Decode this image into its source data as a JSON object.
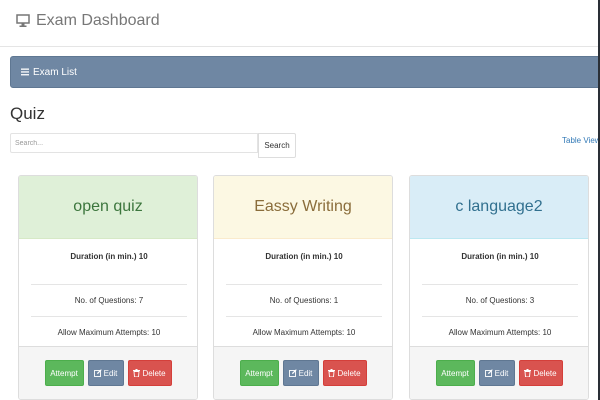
{
  "app": {
    "title": "Exam Dashboard",
    "icon": "monitor-icon"
  },
  "panel": {
    "heading": "Exam List",
    "icon": "list-icon"
  },
  "page": {
    "title": "Quiz"
  },
  "search": {
    "placeholder": "Search...",
    "button_label": "Search"
  },
  "table_view_link": "Table View",
  "cards": [
    {
      "title": "open quiz",
      "theme": "green",
      "duration": "Duration (in min.) 10",
      "questions": "No. of Questions: 7",
      "attempts": "Allow Maximum Attempts: 10",
      "attempt_label": "Attempt",
      "edit_label": "Edit",
      "delete_label": "Delete"
    },
    {
      "title": "Eassy Writing",
      "theme": "yellow",
      "duration": "Duration (in min.) 10",
      "questions": "No. of Questions: 1",
      "attempts": "Allow Maximum Attempts: 10",
      "attempt_label": "Attempt",
      "edit_label": "Edit",
      "delete_label": "Delete"
    },
    {
      "title": "c language2",
      "theme": "blue",
      "duration": "Duration (in min.) 10",
      "questions": "No. of Questions: 3",
      "attempts": "Allow Maximum Attempts: 10",
      "attempt_label": "Attempt",
      "edit_label": "Edit",
      "delete_label": "Delete"
    }
  ],
  "colors": {
    "panel_heading": "#6f87a3",
    "attempt": "#5cb85c",
    "edit": "#6f87a3",
    "delete": "#d9534f",
    "link": "#337ab7"
  },
  "icons": {
    "edit": "pencil-square-icon",
    "delete": "trash-icon"
  }
}
